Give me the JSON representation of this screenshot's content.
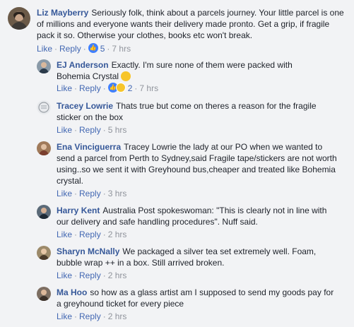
{
  "actions": {
    "like": "Like",
    "reply": "Reply",
    "sep": "·"
  },
  "comments": [
    {
      "author": "Liz Mayberry",
      "text": "Seriously folk, think about a parcels journey. Your little parcel is one of millions and everyone wants their delivery made pronto. Get a grip, if fragile pack it so. Otherwise your clothes, books etc won't break.",
      "reactions": "5",
      "time": "7 hrs",
      "reaction_icons": [
        "like-icon"
      ]
    },
    {
      "author": "EJ Anderson",
      "text": "Exactly. I'm sure none of them were packed with Bohemia Crystal",
      "emoji": "laughing-emoji",
      "reactions": "2",
      "time": "7 hrs",
      "reaction_icons": [
        "like-icon",
        "haha-icon"
      ]
    },
    {
      "author": "Tracey Lowrie",
      "text": "Thats true but come on theres a reason for the fragile sticker on the box",
      "time": "5 hrs"
    },
    {
      "author": "Ena Vinciguerra",
      "text": "Tracey Lowrie the lady at our PO when we wanted to send a parcel from Perth to Sydney,said Fragile tape/stickers are not worth using..so we sent it with Greyhound bus,cheaper and treated like Bohemia crystal.",
      "time": "3 hrs"
    },
    {
      "author": "Harry Kent",
      "text": "Australia Post spokeswoman: \"This is clearly not in line with our delivery and safe handling procedures\". Nuff said.",
      "time": "2 hrs"
    },
    {
      "author": "Sharyn McNally",
      "text": "We packaged a silver tea set extremely well. Foam, bubble wrap ++ in a box. Still arrived broken.",
      "time": "2 hrs"
    },
    {
      "author": "Ma Hoo",
      "text": "so how as a glass artist am I supposed to send my goods pay for a greyhound ticket for every piece",
      "time": "2 hrs"
    }
  ],
  "colors": {
    "background": "#f2f3f5",
    "author": "#365899",
    "link": "#4267b2",
    "meta": "#90949c",
    "like_blue": "#4080ff",
    "haha_yellow": "#f7c52a"
  }
}
